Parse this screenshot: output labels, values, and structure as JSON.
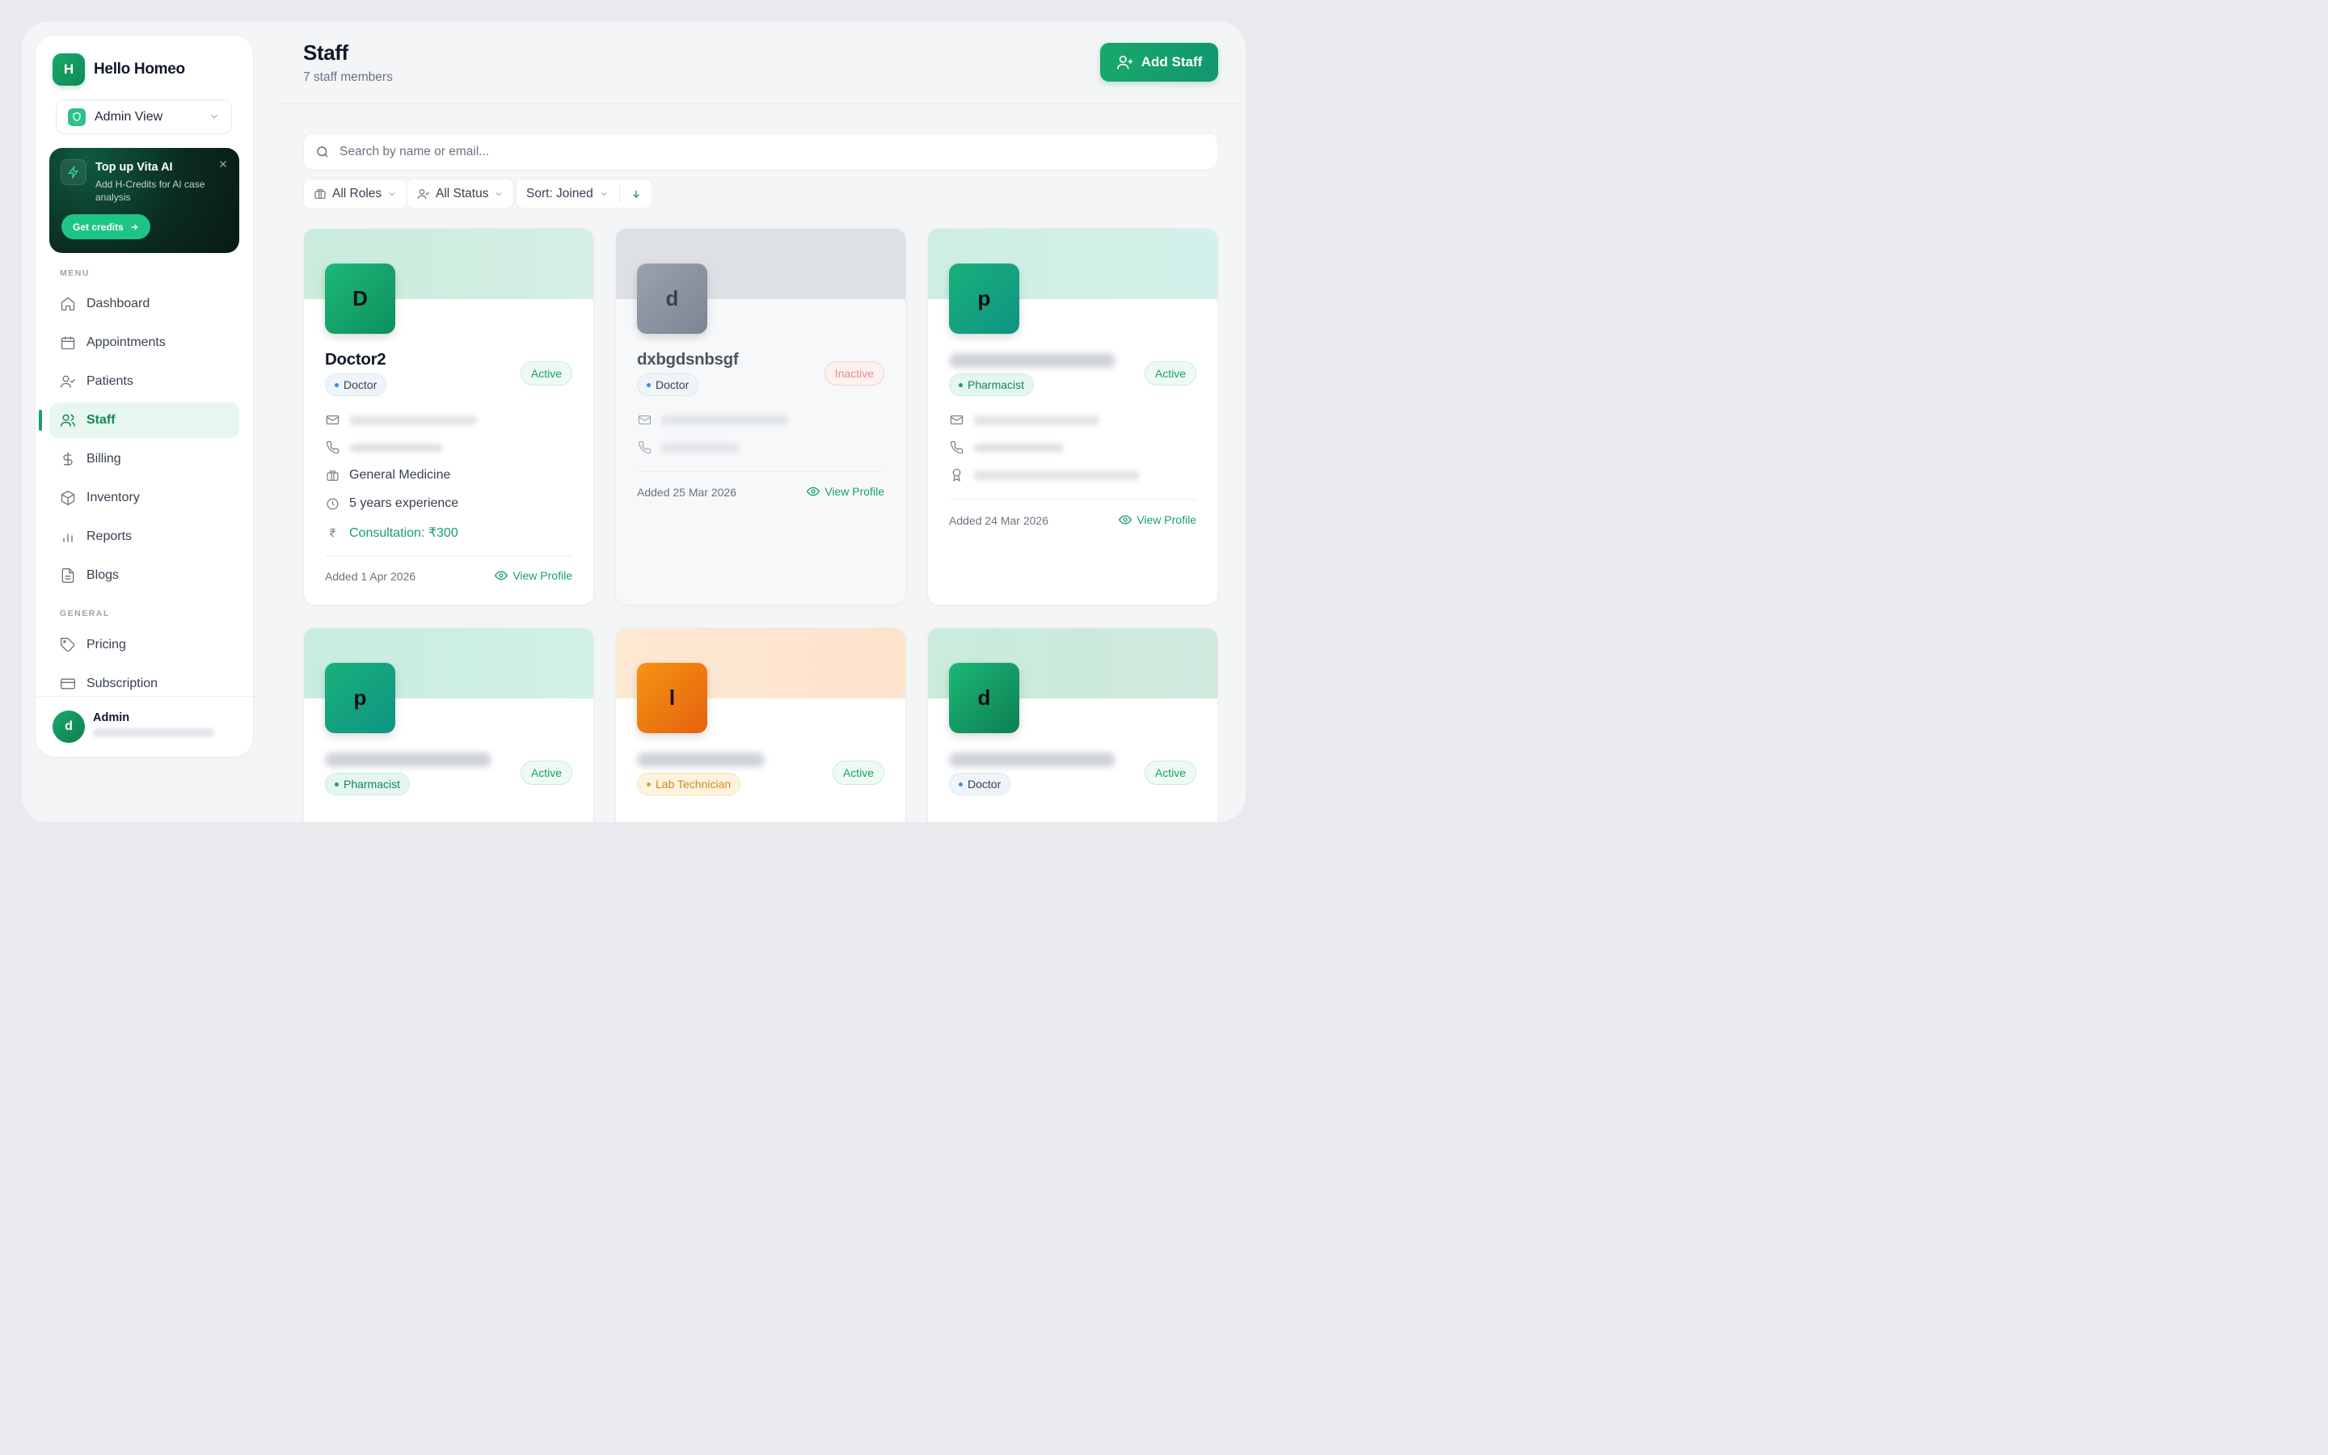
{
  "brand": {
    "logo_letter": "H",
    "name": "Hello Homeo"
  },
  "view_select": {
    "label": "Admin View"
  },
  "promo": {
    "title": "Top up Vita AI",
    "description": "Add H-Credits for AI case analysis",
    "button": "Get credits"
  },
  "sidebar": {
    "menu_label": "MENU",
    "menu": [
      {
        "label": "Dashboard",
        "icon": "home-icon"
      },
      {
        "label": "Appointments",
        "icon": "calendar-icon"
      },
      {
        "label": "Patients",
        "icon": "user-check-icon"
      },
      {
        "label": "Staff",
        "icon": "users-icon",
        "active": true
      },
      {
        "label": "Billing",
        "icon": "dollar-icon"
      },
      {
        "label": "Inventory",
        "icon": "box-icon"
      },
      {
        "label": "Reports",
        "icon": "bar-chart-icon"
      },
      {
        "label": "Blogs",
        "icon": "file-text-icon"
      }
    ],
    "general_label": "GENERAL",
    "general": [
      {
        "label": "Pricing",
        "icon": "tag-icon"
      },
      {
        "label": "Subscription",
        "icon": "credit-card-icon"
      }
    ]
  },
  "user": {
    "initial": "d",
    "name": "Admin"
  },
  "header": {
    "title": "Staff",
    "subtitle": "7 staff members",
    "add_button": "Add Staff"
  },
  "search": {
    "placeholder": "Search by name or email..."
  },
  "filters": {
    "roles": "All Roles",
    "status": "All Status",
    "sort": "Sort: Joined"
  },
  "cards": [
    {
      "initial": "D",
      "name": "Doctor2",
      "role": "Doctor",
      "status": "Active",
      "specialty": "General Medicine",
      "experience": "5 years experience",
      "fee": "Consultation: ₹300",
      "added": "Added 1 Apr 2026",
      "view": "View Profile"
    },
    {
      "initial": "d",
      "name": "dxbgdsnbsgf",
      "role": "Doctor",
      "status": "Inactive",
      "added": "Added 25 Mar 2026",
      "view": "View Profile"
    },
    {
      "initial": "p",
      "role": "Pharmacist",
      "status": "Active",
      "added": "Added 24 Mar 2026",
      "view": "View Profile"
    },
    {
      "initial": "p",
      "role": "Pharmacist",
      "status": "Active"
    },
    {
      "initial": "l",
      "role": "Lab Technician",
      "status": "Active"
    },
    {
      "initial": "d",
      "role": "Doctor",
      "status": "Active"
    }
  ],
  "colors": {
    "accent": "#16a06a",
    "accent_light": "#e7f6ee",
    "inactive": "#ec8a8a",
    "lab": "#e67712"
  }
}
